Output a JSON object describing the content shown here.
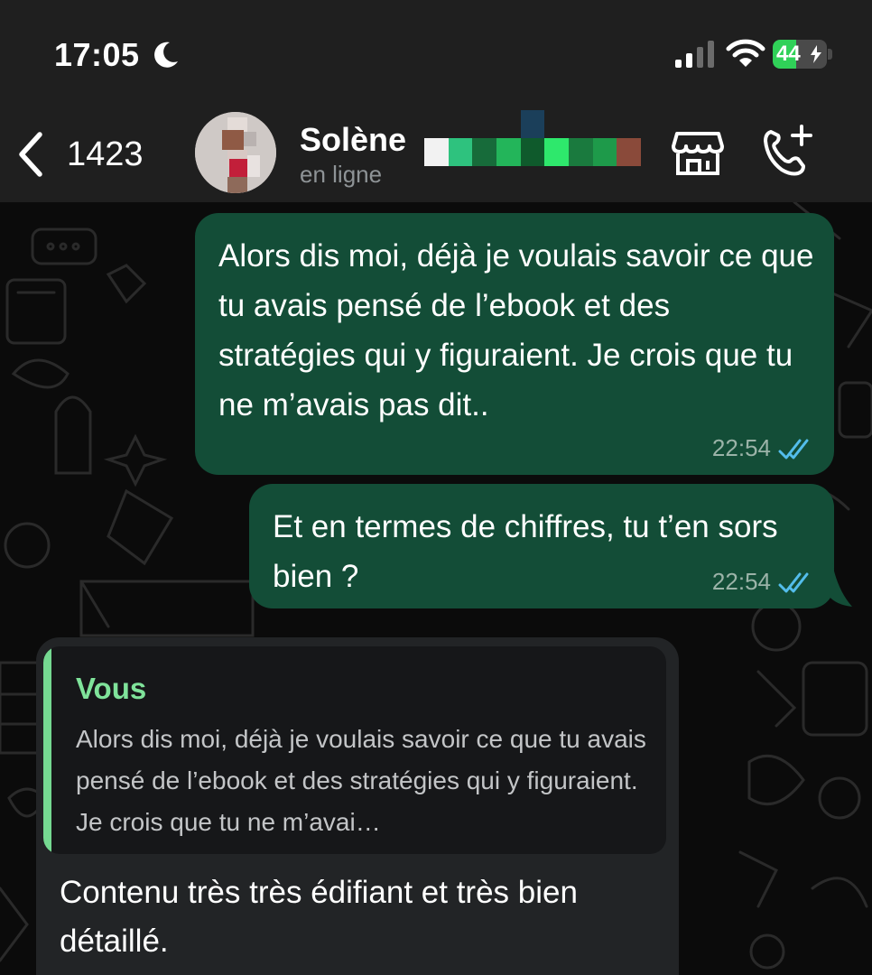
{
  "status_bar": {
    "time": "17:05",
    "moon_icon": "moon-icon",
    "battery_level": 44,
    "battery_text": "44",
    "colors": {
      "battery": "#30d158"
    }
  },
  "header": {
    "back_count": "1423",
    "contact_name": "Solène",
    "contact_status": "en ligne",
    "icons": [
      "back-chevron-icon",
      "store-icon",
      "add-call-icon"
    ]
  },
  "messages": [
    {
      "direction": "outgoing",
      "text": "Alors dis moi, déjà je voulais savoir ce que tu avais pensé de l’ebook et des stratégies qui y figuraient. Je crois que tu ne m’avais pas dit..",
      "time": "22:54",
      "status": "read"
    },
    {
      "direction": "outgoing",
      "text": "Et en termes de chiffres, tu t’en sors bien ?",
      "time": "22:54",
      "status": "read"
    },
    {
      "direction": "incoming",
      "quote": {
        "author": "Vous",
        "text": "Alors dis moi, déjà je voulais savoir ce que tu avais pensé de l’ebook et des stratégies qui y figuraient. Je crois que tu ne m’avai…"
      },
      "text": "Contenu très très édifiant et très bien détaillé."
    }
  ],
  "colors": {
    "header_bg": "#1f1f1f",
    "chat_bg": "#0b0b0b",
    "outgoing_bubble": "#134d37",
    "incoming_bubble": "#222426",
    "quote_accent": "#75d991",
    "read_ticks": "#53bdeb"
  }
}
